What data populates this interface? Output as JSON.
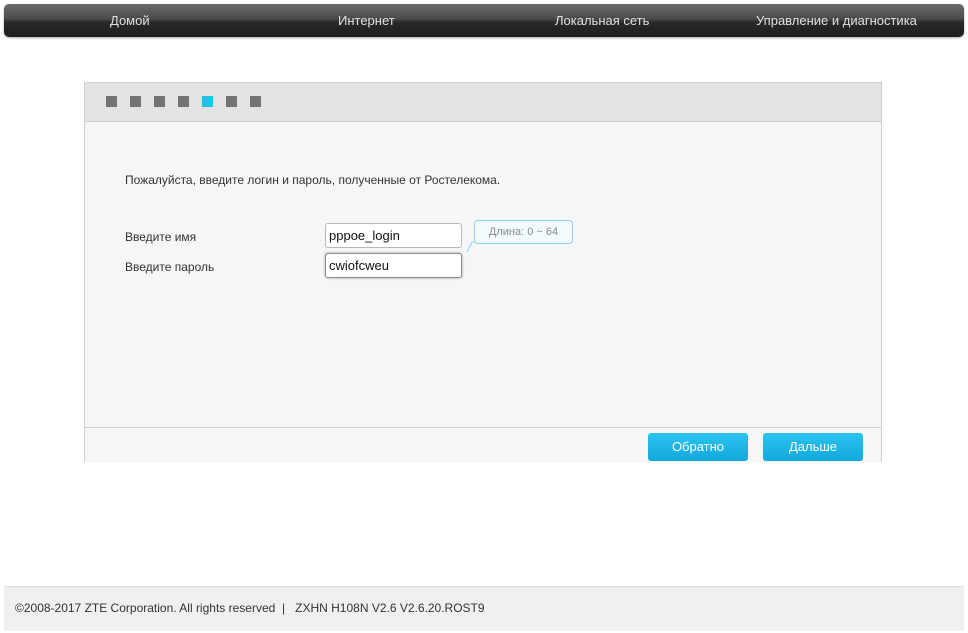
{
  "nav": {
    "items": [
      {
        "label": "Домой"
      },
      {
        "label": "Интернет"
      },
      {
        "label": "Локальная сеть"
      },
      {
        "label": "Управление и диагностика"
      }
    ]
  },
  "wizard": {
    "steps_total": 7,
    "active_step": 5,
    "active_color": "#1fc3e6",
    "inactive_color": "#737373",
    "intro": "Пожалуйста, введите логин и пароль, полученные от Ростелекома.",
    "username": {
      "label": "Введите имя",
      "value": "pppoe_login"
    },
    "password": {
      "label": "Введите пароль",
      "value": "cwiofcweu"
    },
    "hint": "Длина: 0 ~ 64",
    "buttons": {
      "back": "Обратно",
      "next": "Дальше"
    }
  },
  "footer": {
    "copyright": "©2008-2017 ZTE Corporation. All rights reserved",
    "separator": "|",
    "version": "ZXHN H108N V2.6 V2.6.20.ROST9"
  },
  "colors": {
    "button": "#14a8dc",
    "nav_dark": "#1d1d1d"
  }
}
